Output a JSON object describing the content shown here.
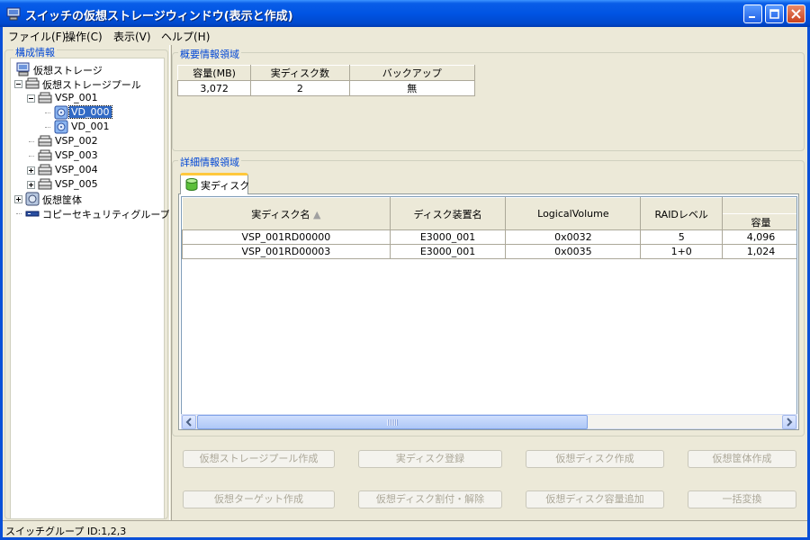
{
  "window": {
    "title": "スイッチの仮想ストレージウィンドウ(表示と作成)"
  },
  "menu": [
    "ファイル(F)",
    "操作(C)",
    "表示(V)",
    "ヘルプ(H)"
  ],
  "left_panel": {
    "title": "構成情報",
    "tree": [
      {
        "label": "仮想ストレージ",
        "icon": "storage-computer-icon",
        "level": 0
      },
      {
        "label": "仮想ストレージプール",
        "icon": "storage-pool-icon",
        "level": 1,
        "expander": "minus"
      },
      {
        "label": "VSP_001",
        "icon": "storage-pool-icon",
        "level": 2,
        "expander": "minus"
      },
      {
        "label": "VD_000",
        "icon": "virtual-disk-icon",
        "level": 3,
        "selected": true
      },
      {
        "label": "VD_001",
        "icon": "virtual-disk-icon",
        "level": 3
      },
      {
        "label": "VSP_002",
        "icon": "storage-pool-icon",
        "level": 2
      },
      {
        "label": "VSP_003",
        "icon": "storage-pool-icon",
        "level": 2
      },
      {
        "label": "VSP_004",
        "icon": "storage-pool-icon",
        "level": 2,
        "expander": "plus"
      },
      {
        "label": "VSP_005",
        "icon": "storage-pool-icon",
        "level": 2,
        "expander": "plus"
      },
      {
        "label": "仮想筐体",
        "icon": "virtual-enclosure-icon",
        "level": 1,
        "expander": "plus"
      },
      {
        "label": "コピーセキュリティグループ",
        "icon": "copy-security-group-icon",
        "level": 1
      }
    ]
  },
  "summary": {
    "title": "概要情報領域",
    "headers": [
      "容量(MB)",
      "実ディスク数",
      "バックアップ"
    ],
    "values": [
      "3,072",
      "2",
      "無"
    ]
  },
  "detail": {
    "title": "詳細情報領域",
    "tab_label": "実ディスク",
    "headers": [
      "実ディスク名",
      "ディスク装置名",
      "LogicalVolume",
      "RAIDレベル",
      "容量"
    ],
    "sort_indicator": "▲",
    "rows": [
      [
        "VSP_001RD00000",
        "E3000_001",
        "0x0032",
        "5",
        "4,096"
      ],
      [
        "VSP_001RD00003",
        "E3000_001",
        "0x0035",
        "1+0",
        "1,024"
      ]
    ]
  },
  "buttons": {
    "row1": [
      "仮想ストレージプール作成",
      "実ディスク登録",
      "仮想ディスク作成",
      "仮想筐体作成"
    ],
    "row2": [
      "仮想ターゲット作成",
      "仮想ディスク割付・解除",
      "仮想ディスク容量追加",
      "一括変換"
    ]
  },
  "status": "スイッチグループ ID:1,2,3",
  "colors": {
    "titlebar": "#0054e3",
    "group_title": "#0046d5",
    "selection": "#316ac5",
    "tab_highlight": "#ffc83c"
  }
}
